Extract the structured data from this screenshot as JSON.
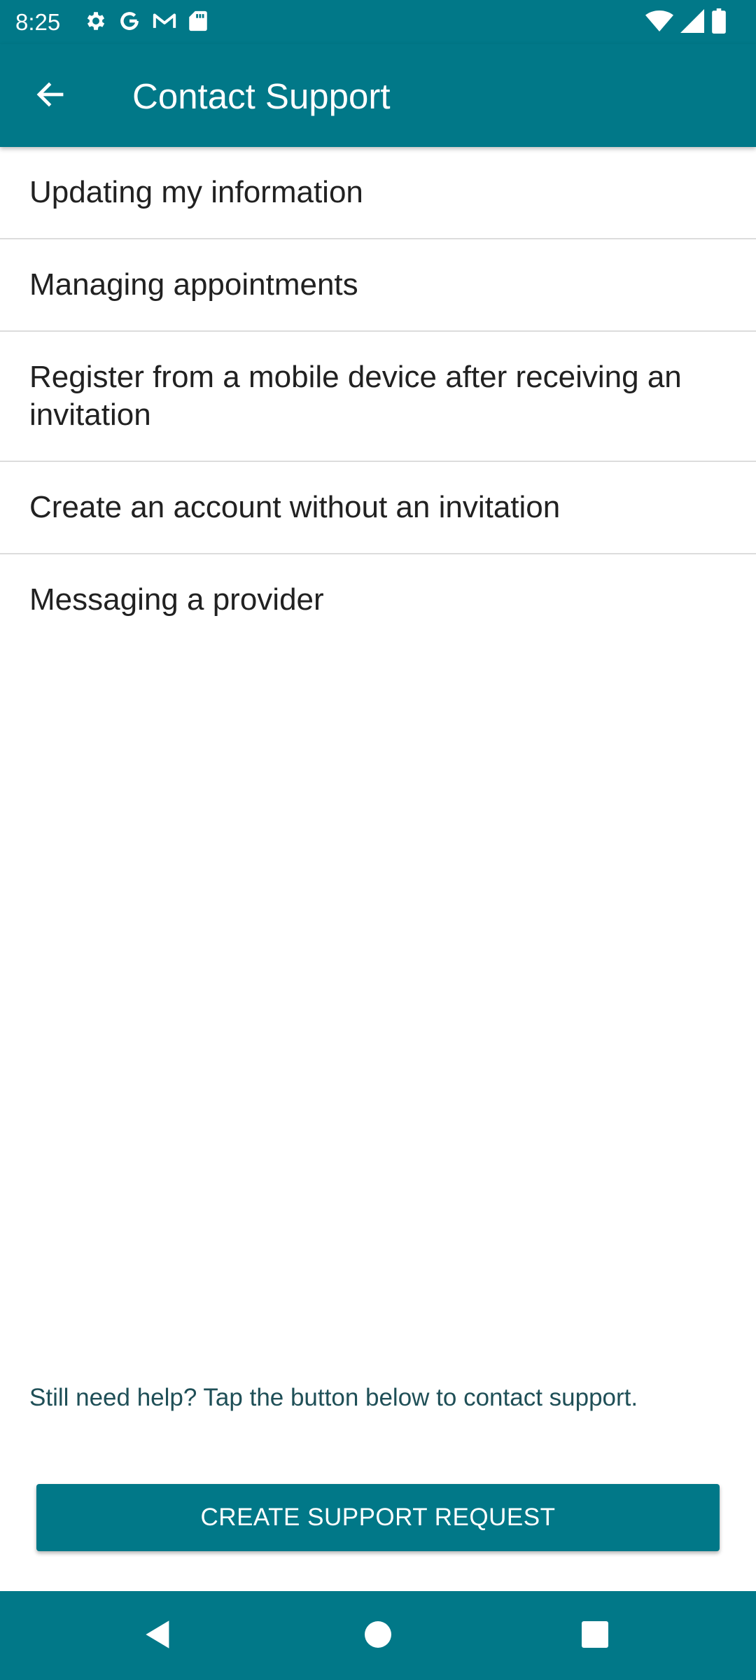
{
  "status_bar": {
    "time": "8:25",
    "left_icons": [
      "gear-icon",
      "google-icon",
      "gmail-icon",
      "sd-card-icon"
    ],
    "right_icons": [
      "wifi-icon",
      "signal-icon",
      "battery-icon"
    ]
  },
  "app_bar": {
    "title": "Contact Support",
    "back_icon": "arrow-left-icon",
    "color": "#017888"
  },
  "topics": [
    {
      "label": "Updating my information"
    },
    {
      "label": "Managing appointments"
    },
    {
      "label": "Register from a mobile device after receiving an invitation"
    },
    {
      "label": "Create an account without an invitation"
    },
    {
      "label": "Messaging a provider"
    }
  ],
  "footer": {
    "help_text": "Still need help? Tap the button below to contact support.",
    "button_label": "CREATE SUPPORT REQUEST"
  },
  "nav_bar": {
    "icons": [
      "back-triangle-icon",
      "home-circle-icon",
      "recents-square-icon"
    ]
  }
}
